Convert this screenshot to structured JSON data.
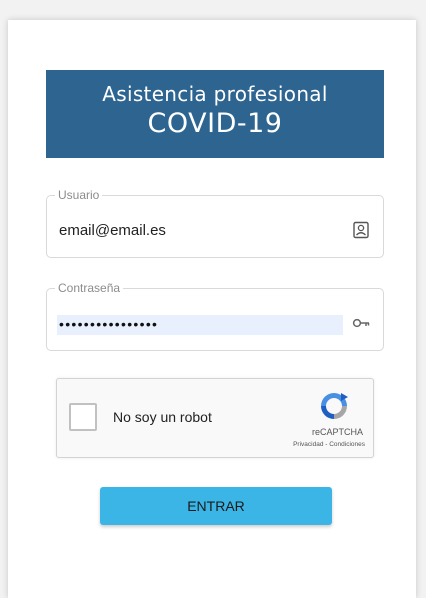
{
  "banner": {
    "line1": "Asistencia profesional",
    "line2": "COVID-19"
  },
  "user_field": {
    "label": "Usuario",
    "value": "email@email.es",
    "icon": "contact-card-icon"
  },
  "password_field": {
    "label": "Contraseña",
    "value_masked": "••••••••••••••••",
    "icon": "key-icon"
  },
  "captcha": {
    "label": "No soy un robot",
    "brand": "reCAPTCHA",
    "links": "Privacidad - Condiciones"
  },
  "submit": {
    "label": "ENTRAR"
  },
  "colors": {
    "banner_bg": "#2d6490",
    "button_bg": "#3bb5e6",
    "autofill_bg": "#e8f0fe"
  }
}
